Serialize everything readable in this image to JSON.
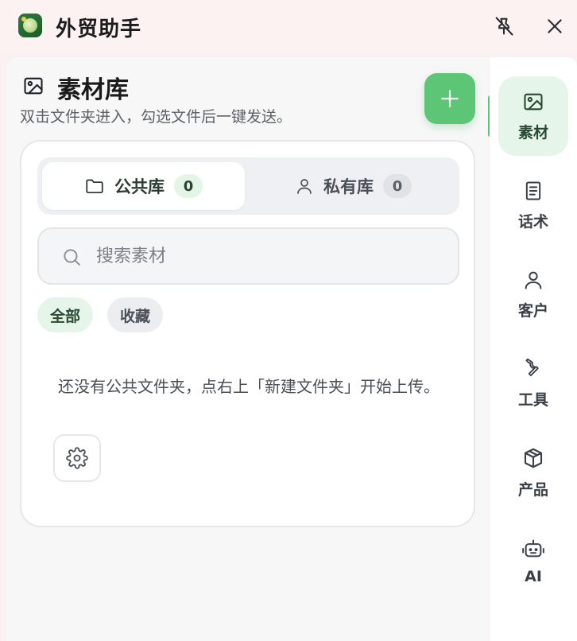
{
  "titlebar": {
    "app_title": "外贸助手",
    "pin_icon": "pin-off-icon",
    "close_icon": "close-icon"
  },
  "library": {
    "title": "素材库",
    "subtitle": "双击文件夹进入，勾选文件后一键发送。",
    "add_icon": "plus-icon",
    "tabs": [
      {
        "label": "公共库",
        "count": "0",
        "icon": "folder-icon"
      },
      {
        "label": "私有库",
        "count": "0",
        "icon": "user-icon"
      }
    ],
    "search": {
      "placeholder": "搜索素材",
      "value": ""
    },
    "filters": [
      {
        "label": "全部",
        "active": true
      },
      {
        "label": "收藏",
        "active": false
      }
    ],
    "empty_message": "还没有公共文件夹，点右上「新建文件夹」开始上传。"
  },
  "sidebar": {
    "items": [
      {
        "label": "素材",
        "icon": "image-icon",
        "active": true
      },
      {
        "label": "话术",
        "icon": "document-icon",
        "active": false
      },
      {
        "label": "客户",
        "icon": "user-icon",
        "active": false
      },
      {
        "label": "工具",
        "icon": "wrench-icon",
        "active": false
      },
      {
        "label": "产品",
        "icon": "package-icon",
        "active": false
      },
      {
        "label": "AI",
        "icon": "robot-icon",
        "active": false
      }
    ]
  },
  "colors": {
    "accent": "#5cc576",
    "accent_soft": "#e6f5e9",
    "titlebar_bg": "#fcf2f2",
    "panel_bg": "#f7f7f8"
  }
}
